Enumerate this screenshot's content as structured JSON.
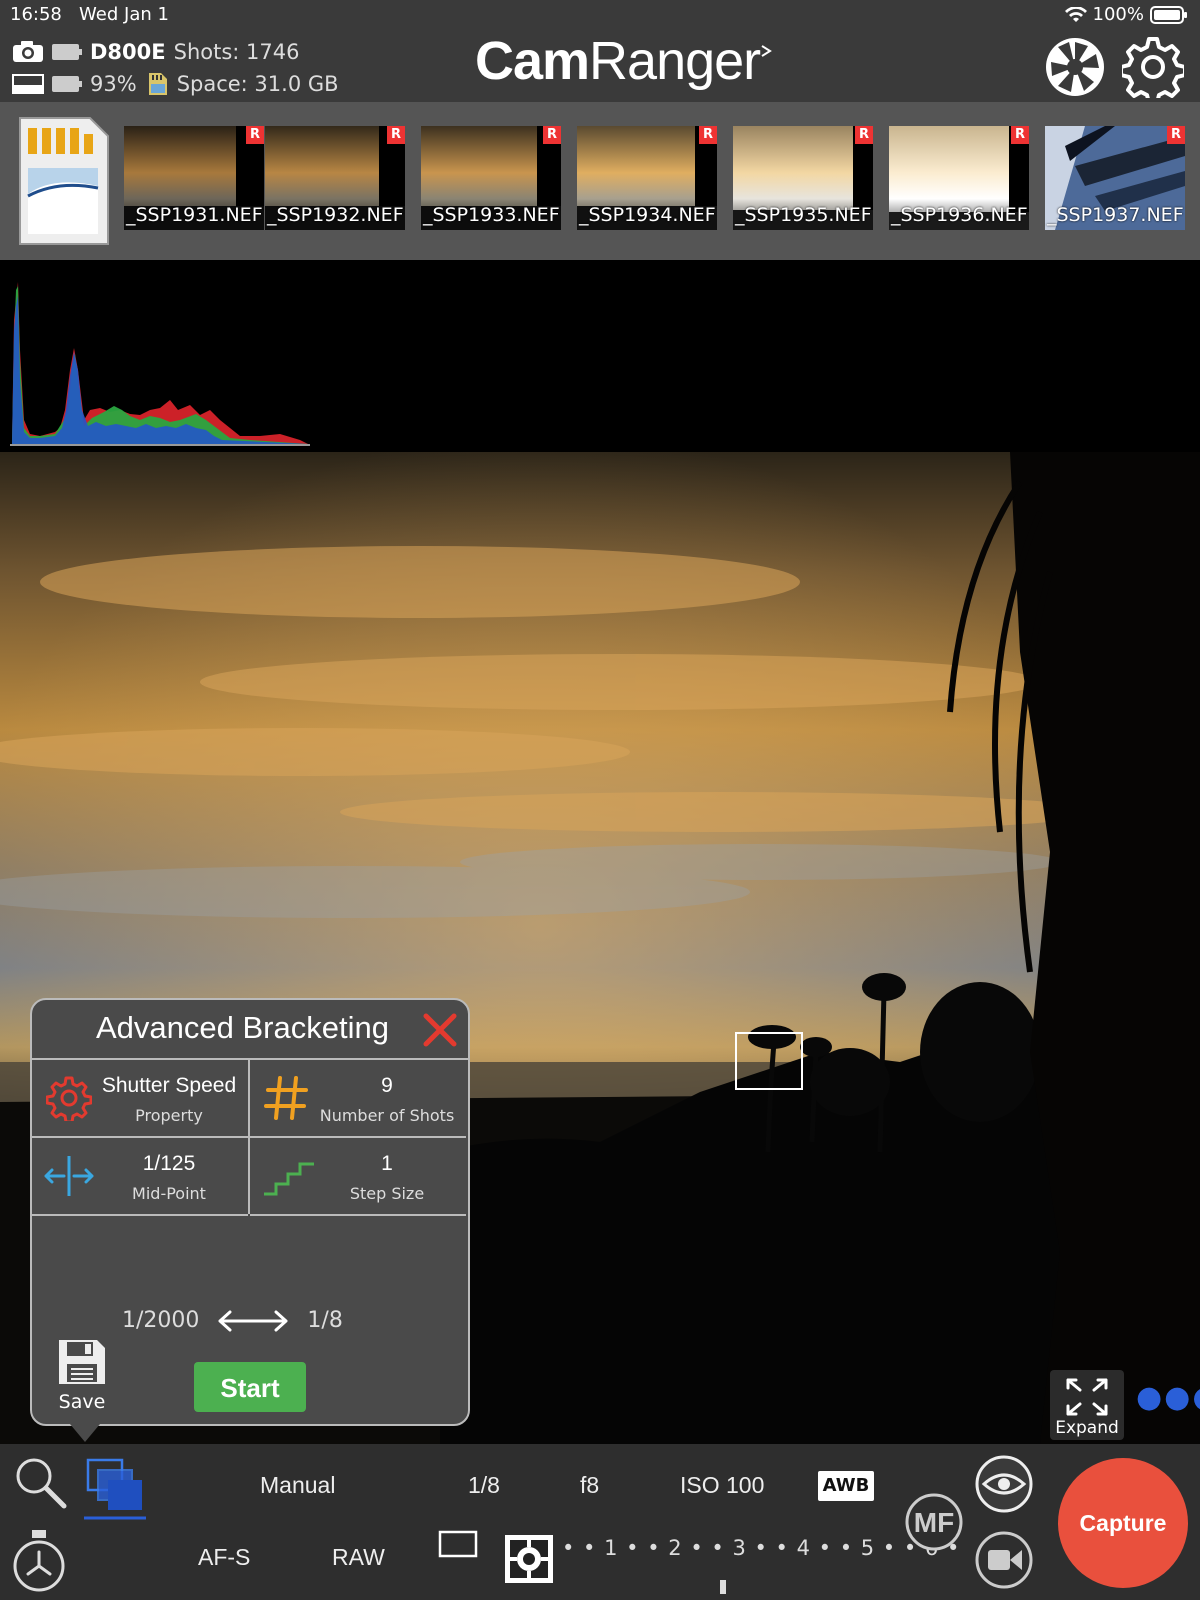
{
  "status": {
    "time": "16:58",
    "date": "Wed Jan 1",
    "battery": "100%"
  },
  "camera": {
    "model": "D800E",
    "shots": "Shots: 1746",
    "battery": "93%",
    "space": "Space: 31.0 GB"
  },
  "brand": {
    "cam": "Cam",
    "ranger": "Ranger"
  },
  "thumbnails": [
    {
      "name": "_SSP1931.NEF",
      "badge": "R"
    },
    {
      "name": "_SSP1932.NEF",
      "badge": "R"
    },
    {
      "name": "_SSP1933.NEF",
      "badge": "R"
    },
    {
      "name": "_SSP1934.NEF",
      "badge": "R"
    },
    {
      "name": "_SSP1935.NEF",
      "badge": "R"
    },
    {
      "name": "_SSP1936.NEF",
      "badge": "R"
    },
    {
      "name": "_SSP1937.NEF",
      "badge": "R"
    }
  ],
  "bracketing": {
    "title": "Advanced Bracketing",
    "property_value": "Shutter Speed",
    "property_label": "Property",
    "shots_value": "9",
    "shots_label": "Number of Shots",
    "midpoint_value": "1/125",
    "midpoint_label": "Mid-Point",
    "step_value": "1",
    "step_label": "Step Size",
    "range_start": "1/2000",
    "range_end": "1/8",
    "start_label": "Start",
    "save_label": "Save"
  },
  "expand_label": "Expand",
  "toolbar": {
    "mode": "Manual",
    "shutter": "1/8",
    "aperture": "f8",
    "iso": "ISO 100",
    "wb": "AWB",
    "focus_mode": "AF-S",
    "format": "RAW",
    "mf": "MF",
    "capture": "Capture",
    "exposure_scale": "• • 1 • • 2 • • 3 • • 4 • • 5 • • 6 •"
  },
  "colors": {
    "capture": "#e9503d",
    "start": "#4cb050",
    "accent_blue": "#2a5fd8",
    "close_red": "#e33a2f",
    "badge_red": "#e33333"
  }
}
